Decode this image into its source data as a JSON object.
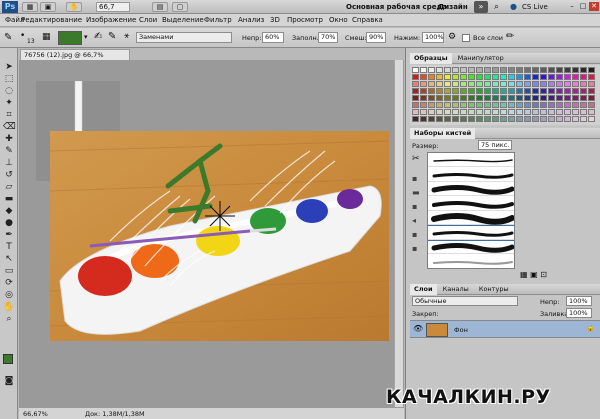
{
  "appbar": {
    "logo": "Ps",
    "zoom": "66,7",
    "workspace_label": "Основная рабочая среда",
    "design_label": "Дизайн",
    "more_label": "»",
    "cslive_label": "CS Live"
  },
  "menu": [
    "Файл",
    "Редактирование",
    "Изображение",
    "Слои",
    "Выделение",
    "Фильтр",
    "Анализ",
    "3D",
    "Просмотр",
    "Окно",
    "Справка"
  ],
  "options": {
    "brush_size": "13",
    "mode_label": "Режим:",
    "mode_value": "Заменами",
    "opacity_label": "Непр:",
    "opacity_value": "60%",
    "fill_label": "Заполн.:",
    "fill_value": "70%",
    "mix_label": "Смеш:",
    "mix_value": "90%",
    "flow_label": "Нажим:",
    "flow_value": "100%",
    "all_layers_label": "Все слои"
  },
  "document": {
    "tab_title": "76756 (12).jpg @ 66,7% (RGB/8) *",
    "zoom_status": "66,67%",
    "doc_status": "Док: 1,38M/1,38M"
  },
  "swatches_panel": {
    "tab_active": "Образцы",
    "tab_inactive": "Манипулятор"
  },
  "brush_panel": {
    "title": "Наборы кистей",
    "size_label": "Размер:",
    "size_value": "75 пикс."
  },
  "layers_panel": {
    "tabs": [
      "Слои",
      "Каналы",
      "Контуры"
    ],
    "blend_mode": "Обычные",
    "opacity_label": "Непр:",
    "opacity_value": "100%",
    "lock_label": "Закреп:",
    "fill_label": "Заливка:",
    "fill_value": "100%",
    "layer_name": "Фон"
  },
  "watermark": "КАЧАЛКИН.РУ",
  "colors": {
    "foreground": "#3a7a2a",
    "accent": "#1d4f8a"
  }
}
